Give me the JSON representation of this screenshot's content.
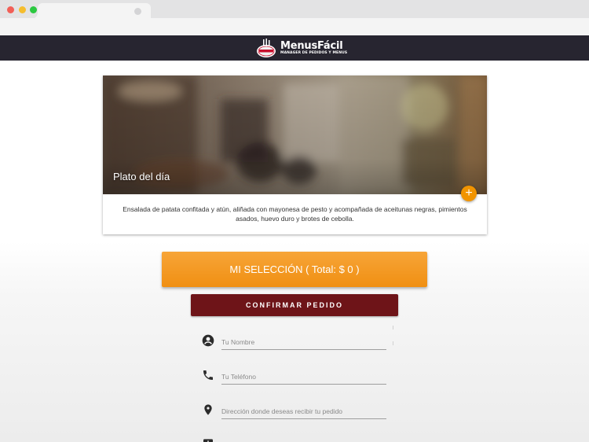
{
  "app": {
    "logo_title": "MenusFácil",
    "logo_subtitle": "MANAGER DE PEDIDOS Y MENUS",
    "logo_badge_text": "MenusFácil"
  },
  "card": {
    "title": "Plato del día",
    "description": "Ensalada de patata confitada y atún, aliñada con mayonesa de pesto y acompañada de aceitunas negras, pimientos asados, huevo duro y brotes de cebolla.",
    "add_label": "+"
  },
  "selection": {
    "label": "MI SELECCIÓN ( Total: $ 0 )"
  },
  "confirm": {
    "label": "CONFIRMAR PEDIDO"
  },
  "form": {
    "name_placeholder": "Tu Nombre",
    "phone_placeholder": "Tu Teléfono",
    "address_placeholder": "Dirección donde deseas recibir tu pedido"
  },
  "colors": {
    "header_bg": "#272530",
    "accent_orange": "#f29400",
    "confirm_bg": "#6e1418"
  },
  "icons": {
    "name": "account-circle-icon",
    "phone": "phone-icon",
    "address": "location-pin-icon",
    "extra": "note-icon"
  }
}
